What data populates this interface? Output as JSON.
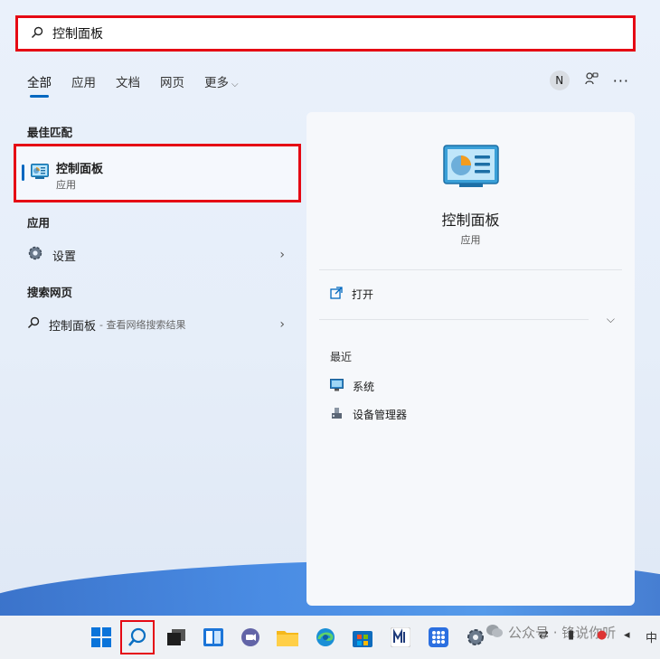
{
  "search": {
    "query": "控制面板"
  },
  "filters": [
    {
      "label": "全部"
    },
    {
      "label": "应用"
    },
    {
      "label": "文档"
    },
    {
      "label": "网页"
    },
    {
      "label": "更多"
    }
  ],
  "account": {
    "initial": "N"
  },
  "sections": {
    "best_match": "最佳匹配",
    "apps": "应用",
    "web": "搜索网页"
  },
  "best_match_item": {
    "title": "控制面板",
    "subtitle": "应用"
  },
  "apps_item": {
    "label": "设置"
  },
  "web_item": {
    "label": "控制面板",
    "hint": "- 查看网络搜索结果"
  },
  "detail": {
    "title": "控制面板",
    "subtitle": "应用",
    "open_label": "打开",
    "recent_label": "最近",
    "recent_items": [
      {
        "label": "系统"
      },
      {
        "label": "设备管理器"
      }
    ]
  },
  "watermark": {
    "text": "公众号 · 锋说你听"
  },
  "tray": {
    "lang": "中"
  },
  "colors": {
    "accent": "#0067c0",
    "highlight": "#e50914"
  }
}
